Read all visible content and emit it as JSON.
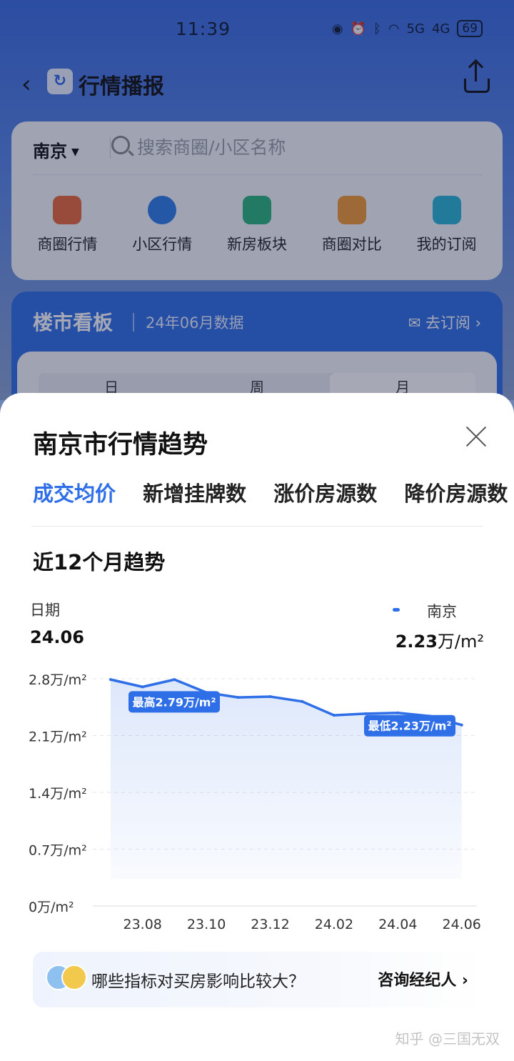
{
  "status": {
    "time": "11:39",
    "network": "5G",
    "network2": "4G",
    "battery": "69"
  },
  "nav": {
    "back": "‹",
    "title": "行情播报"
  },
  "search": {
    "city": "南京",
    "placeholder": "搜索商圈/小区名称"
  },
  "quick": [
    {
      "label": "商圈行情",
      "icon": "house-chart-icon"
    },
    {
      "label": "小区行情",
      "icon": "pie-icon"
    },
    {
      "label": "新房板块",
      "icon": "bar-chart-icon"
    },
    {
      "label": "商圈对比",
      "icon": "vs-house-icon"
    },
    {
      "label": "我的订阅",
      "icon": "bookmark-icon"
    }
  ],
  "board": {
    "title": "楼市看板",
    "subtitle": "24年06月数据",
    "subscribe": "去订阅 ›",
    "periods": [
      "日",
      "周",
      "月"
    ]
  },
  "sheet": {
    "title": "南京市行情趋势",
    "tabs": [
      "成交均价",
      "新增挂牌数",
      "涨价房源数",
      "降价房源数"
    ],
    "trend_title": "近12个月趋势",
    "date_label": "日期",
    "date_value": "24.06",
    "legend_name": "南京",
    "legend_value": "2.23",
    "legend_unit": "万/m²"
  },
  "chart_data": {
    "type": "area",
    "title": "近12个月趋势",
    "series": [
      {
        "name": "南京",
        "values": [
          2.79,
          2.7,
          2.79,
          2.63,
          2.57,
          2.58,
          2.52,
          2.35,
          2.37,
          2.38,
          2.34,
          2.23
        ]
      }
    ],
    "x": [
      "23.07",
      "23.08",
      "23.09",
      "23.10",
      "23.11",
      "23.12",
      "24.01",
      "24.02",
      "24.03",
      "24.04",
      "24.05",
      "24.06"
    ],
    "x_tick_labels": [
      "23.08",
      "23.10",
      "23.12",
      "24.02",
      "24.04",
      "24.06"
    ],
    "y_tick_labels": [
      "0万/m²",
      "0.7万/m²",
      "1.4万/m²",
      "2.1万/m²",
      "2.8万/m²"
    ],
    "ylim": [
      0,
      2.8
    ],
    "annotations": {
      "max_label": "最高2.79万/m²",
      "min_label": "最低2.23万/m²"
    },
    "grid": true,
    "color": "#2e6ee6"
  },
  "tip": {
    "text": "哪些指标对买房影响比较大？",
    "button": "咨询经纪人 ›"
  },
  "watermark": "知乎 @三国无双"
}
